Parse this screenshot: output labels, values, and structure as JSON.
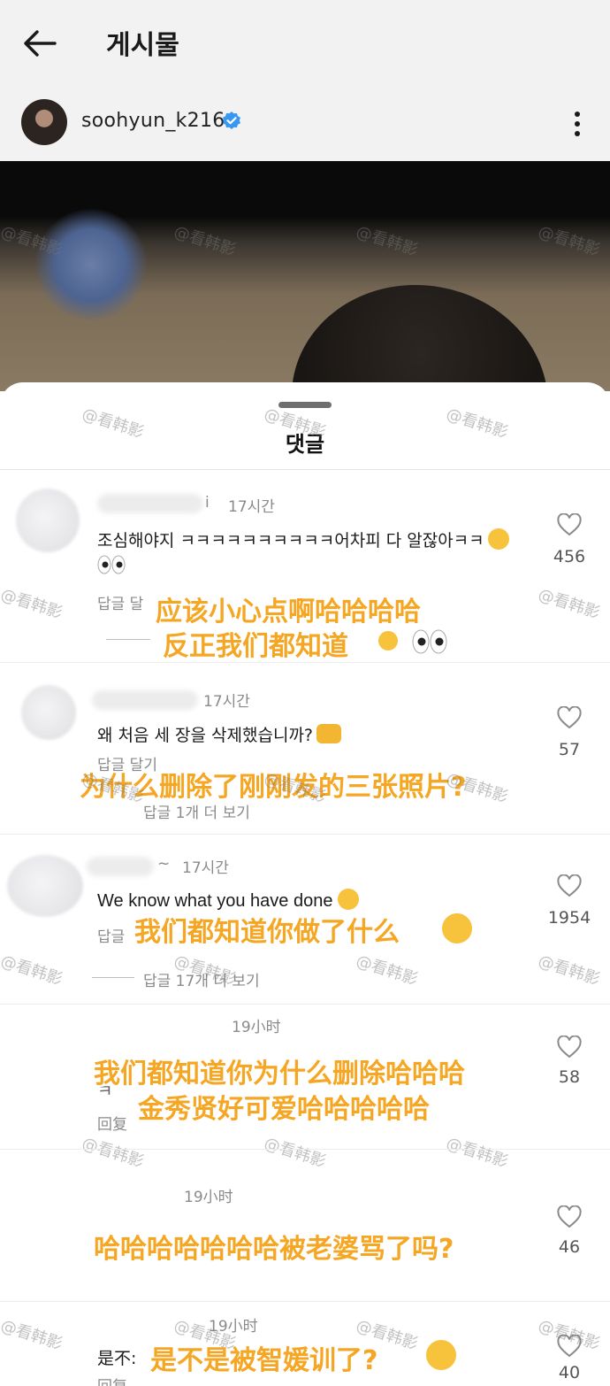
{
  "header": {
    "title": "게시물",
    "back_icon": "arrow-left-icon"
  },
  "profile": {
    "username": "soohyun_k216",
    "verified_icon": "verified-badge-icon",
    "verified_color": "#3897f0",
    "more_icon": "more-vertical-icon"
  },
  "sheet": {
    "title": "댓글"
  },
  "watermark": "@看韩影",
  "comments": [
    {
      "name_fragment": "i",
      "time": "17시간",
      "text_line1": "조심해야지 ㅋㅋㅋㅋㅋㅋㅋㅋㅋㅋ어차피 다 알잖아ㅋㅋ",
      "reply_action": "답글 달",
      "likes": "456",
      "overlay_line1": "应该小心点啊哈哈哈哈",
      "overlay_line2": "反正我们都知道"
    },
    {
      "name_fragment": "",
      "time": "17시간",
      "text_line1": "왜 처음 세 장을 삭제했습니까?",
      "reply_action": "답글 달기",
      "replies": "답글 1개 더 보기",
      "likes": "57",
      "overlay_line1": "为什么删除了刚刚发的三张照片?"
    },
    {
      "name_fragment": "~",
      "time": "17시간",
      "text_line1": "We know what you have done",
      "reply_action": "답글",
      "replies": "답글 17개 더 보기",
      "likes": "1954",
      "overlay_line1": "我们都知道你做了什么"
    },
    {
      "time": "19小时",
      "text_fragment": "ㅋ",
      "reply_action": "回复",
      "likes": "58",
      "overlay_line1": "我们都知道你为什么删除哈哈哈",
      "overlay_line2": "金秀贤好可爱哈哈哈哈哈"
    },
    {
      "time": "19小时",
      "likes": "46",
      "overlay_line1": "哈哈哈哈哈哈哈被老婆骂了吗?"
    },
    {
      "time": "19小时",
      "text_fragment": "是不:",
      "reply_action": "回复",
      "likes": "40",
      "overlay_line1": "是不是被智媛训了?"
    }
  ],
  "colors": {
    "overlay": "#f5a623",
    "heart": "#8a8a8a"
  }
}
